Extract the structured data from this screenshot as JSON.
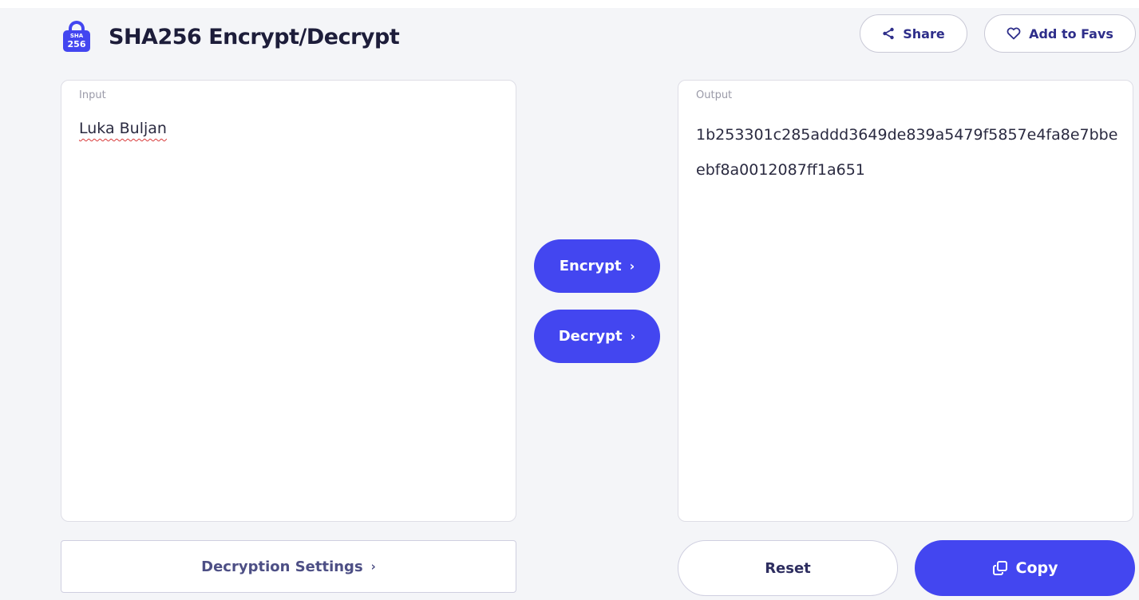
{
  "header": {
    "logo_line1": "SHA",
    "logo_line2": "256",
    "title": "SHA256 Encrypt/Decrypt",
    "share_label": "Share",
    "fav_label": "Add to Favs"
  },
  "input_panel": {
    "label": "Input",
    "value": "Luka Buljan"
  },
  "output_panel": {
    "label": "Output",
    "value": "1b253301c285addd3649de839a5479f5857e4fa8e7bbeebf8a0012087ff1a651"
  },
  "actions": {
    "encrypt_label": "Encrypt",
    "decrypt_label": "Decrypt",
    "chevron": "›"
  },
  "footer": {
    "settings_label": "Decryption Settings",
    "reset_label": "Reset",
    "copy_label": "Copy"
  },
  "colors": {
    "accent": "#4346f0",
    "background": "#f4f5f8"
  },
  "icons": [
    "lock-icon",
    "share-icon",
    "heart-icon",
    "copy-icon",
    "chevron-right-icon"
  ]
}
